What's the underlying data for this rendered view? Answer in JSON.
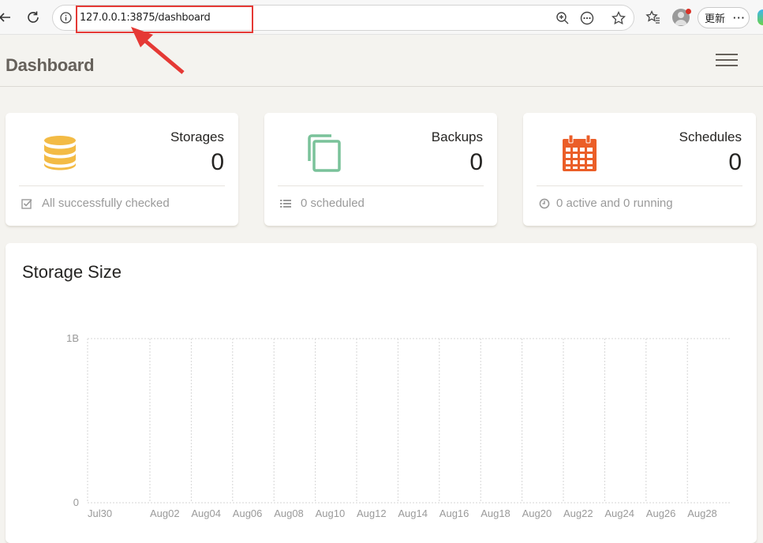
{
  "browser": {
    "url": "127.0.0.1:3875/dashboard",
    "update_label": "更新",
    "more_label": "···",
    "icons": [
      "back-icon",
      "refresh-icon",
      "info-icon",
      "zoom-icon",
      "more-icon",
      "favorite-star-icon",
      "favorites-icon",
      "profile-icon"
    ]
  },
  "header": {
    "title": "Dashboard",
    "menu_icon": "hamburger-menu-icon"
  },
  "stats": [
    {
      "title": "Storages",
      "value": "0",
      "footer": "All successfully checked",
      "icon": "database-icon",
      "footer_icon": "check-square-icon",
      "color": "#f3bb45"
    },
    {
      "title": "Backups",
      "value": "0",
      "footer": "0 scheduled",
      "icon": "copy-icon",
      "footer_icon": "list-icon",
      "color": "#7ac29a"
    },
    {
      "title": "Schedules",
      "value": "0",
      "footer": "0 active and 0 running",
      "icon": "calendar-icon",
      "footer_icon": "clock-icon",
      "color": "#eb5e28"
    }
  ],
  "chart": {
    "title": "Storage Size"
  },
  "chart_data": {
    "type": "line",
    "title": "Storage Size",
    "x": [
      "Jul30",
      "Aug02",
      "Aug04",
      "Aug06",
      "Aug08",
      "Aug10",
      "Aug12",
      "Aug14",
      "Aug16",
      "Aug18",
      "Aug20",
      "Aug22",
      "Aug24",
      "Aug26",
      "Aug28"
    ],
    "y_ticks": [
      "0",
      "1B"
    ],
    "ylim": [
      0,
      1
    ],
    "series": [],
    "grid": true
  }
}
